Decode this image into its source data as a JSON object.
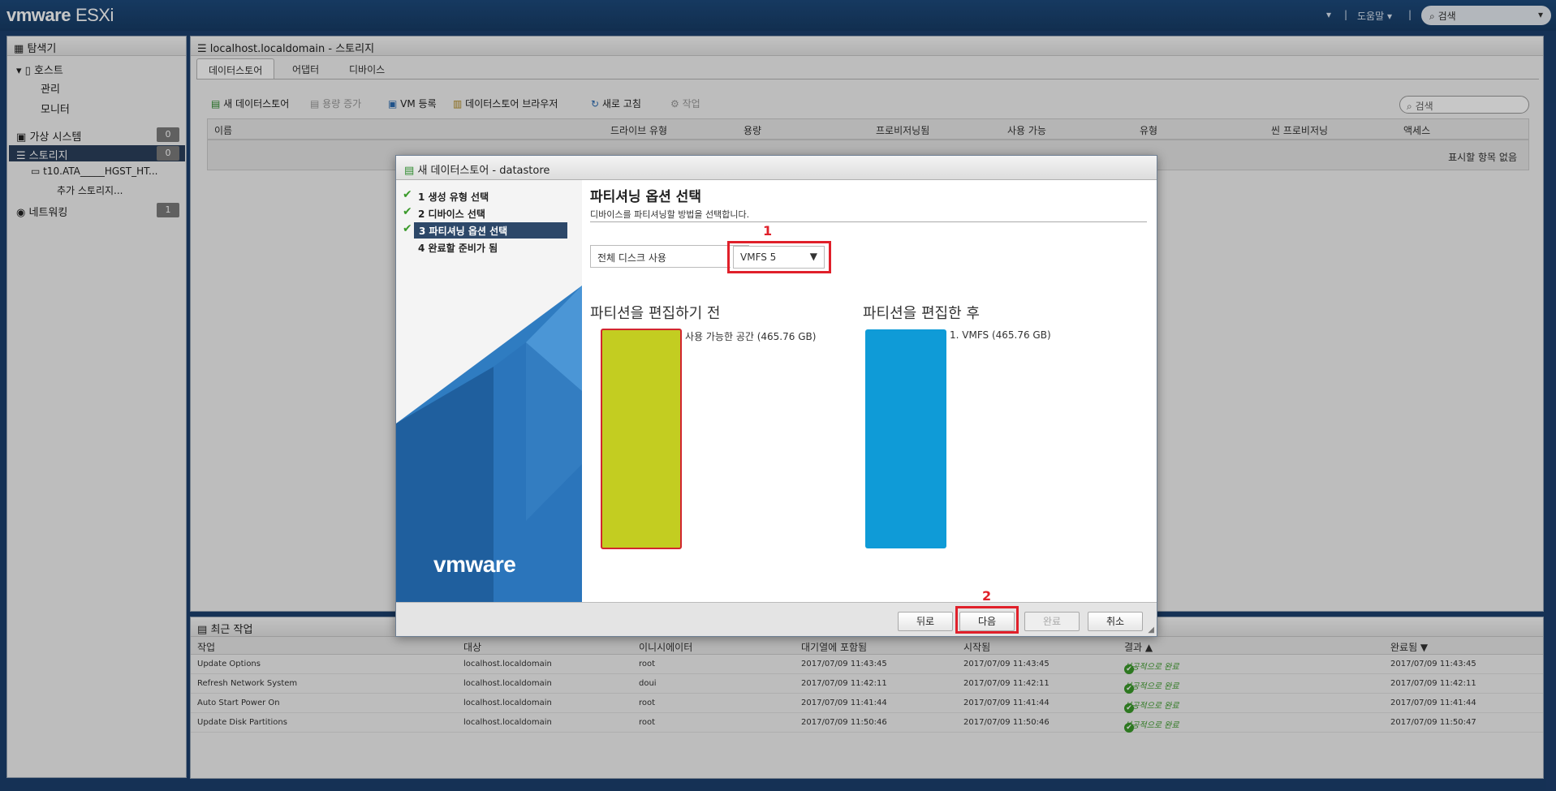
{
  "app": {
    "logo": "vmware",
    "product": "ESXi",
    "help": "도움말",
    "search_placeholder": "검색"
  },
  "navigator": {
    "title": "탐색기",
    "host": "호스트",
    "host_items": [
      "관리",
      "모니터"
    ],
    "vms": "가상 시스템",
    "vms_count": "0",
    "storage": "스토리지",
    "storage_count": "0",
    "storage_sub": [
      "t10.ATA_____HGST_HT...",
      "추가 스토리지..."
    ],
    "network": "네트워킹",
    "network_count": "1"
  },
  "main": {
    "title": "localhost.localdomain - 스토리지",
    "tabs": [
      "데이터스토어",
      "어댑터",
      "디바이스"
    ],
    "toolbar": [
      "새 데이터스토어",
      "용량 증가",
      "VM 등록",
      "데이터스토어 브라우저",
      "새로 고침",
      "작업"
    ],
    "search_placeholder": "검색",
    "columns": [
      "이름",
      "드라이브 유형",
      "용량",
      "프로비저닝됨",
      "사용 가능",
      "유형",
      "씬 프로비저닝",
      "액세스"
    ],
    "empty": "표시할 항목 없음"
  },
  "dialog": {
    "title": "새 데이터스토어 - datastore",
    "steps": [
      "1 생성 유형 선택",
      "2 디바이스 선택",
      "3 파티셔닝 옵션 선택",
      "4 완료할 준비가 됨"
    ],
    "heading": "파티셔닝 옵션 선택",
    "subtitle": "디바이스를 파티셔닝할 방법을 선택합니다.",
    "partition_select": "전체 디스크 사용",
    "vmfs_select": "VMFS 5",
    "before_title": "파티션을 편집하기 전",
    "before_label": "사용 가능한 공간  (465.76 GB)",
    "after_title": "파티션을 편집한 후",
    "after_label": "1. VMFS  (465.76 GB)",
    "buttons": {
      "back": "뒤로",
      "next": "다음",
      "finish": "완료",
      "cancel": "취소"
    },
    "brand": "vmware",
    "annotations": [
      "1",
      "2"
    ],
    "colors": {
      "before": "#c3cd21",
      "after": "#0f9bd7",
      "highlight": "#e0202a"
    }
  },
  "recent": {
    "title": "최근 작업",
    "columns": [
      "작업",
      "대상",
      "이니시에이터",
      "대기열에 포함됨",
      "시작됨",
      "결과 ▲",
      "완료됨 ▼"
    ],
    "rows": [
      [
        "Update Options",
        "localhost.localdomain",
        "root",
        "2017/07/09 11:43:45",
        "2017/07/09 11:43:45",
        "성공적으로 완료",
        "2017/07/09 11:43:45"
      ],
      [
        "Refresh Network System",
        "localhost.localdomain",
        "doui",
        "2017/07/09 11:42:11",
        "2017/07/09 11:42:11",
        "성공적으로 완료",
        "2017/07/09 11:42:11"
      ],
      [
        "Auto Start Power On",
        "localhost.localdomain",
        "root",
        "2017/07/09 11:41:44",
        "2017/07/09 11:41:44",
        "성공적으로 완료",
        "2017/07/09 11:41:44"
      ],
      [
        "Update Disk Partitions",
        "localhost.localdomain",
        "root",
        "2017/07/09 11:50:46",
        "2017/07/09 11:50:46",
        "성공적으로 완료",
        "2017/07/09 11:50:47"
      ]
    ]
  }
}
